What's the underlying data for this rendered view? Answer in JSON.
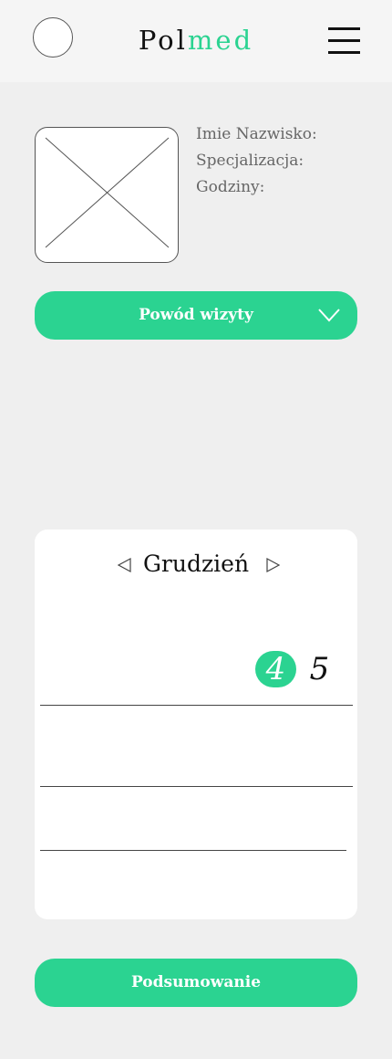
{
  "header": {
    "logo_part1": "Pol",
    "logo_part2": "med",
    "accent_color": "#2bd391"
  },
  "doctor": {
    "name_label": "Imie Nazwisko:",
    "specialization_label": "Specjalizacja:",
    "hours_label": "Godziny:"
  },
  "reason": {
    "label": "Powód wizyty"
  },
  "calendar": {
    "month": "Grudzień",
    "days": [
      {
        "label": "4",
        "selected": true
      },
      {
        "label": "5",
        "selected": false
      }
    ]
  },
  "summary": {
    "label": "Podsumowanie"
  }
}
